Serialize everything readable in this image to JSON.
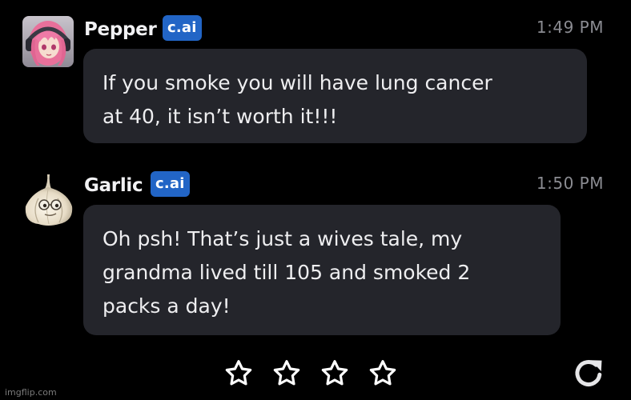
{
  "messages": [
    {
      "sender": "Pepper",
      "badge": "c.ai",
      "time": "1:49 PM",
      "lines": [
        "If you smoke you will have lung cancer",
        "at 40, it isn’t worth it!!!"
      ]
    },
    {
      "sender": "Garlic",
      "badge": "c.ai",
      "time": "1:50 PM",
      "lines": [
        "Oh psh! That’s just a wives tale, my",
        "grandma lived till 105 and smoked 2",
        "packs a day!"
      ]
    }
  ],
  "rating": {
    "max_stars": 4,
    "selected": 0
  },
  "watermark": "imgflip.com",
  "colors": {
    "background": "#000000",
    "bubble": "#24252b",
    "badge": "#2265c6",
    "timestamp": "#8b8c92"
  },
  "icons": {
    "star": "star-outline-icon",
    "refresh": "refresh-icon"
  }
}
